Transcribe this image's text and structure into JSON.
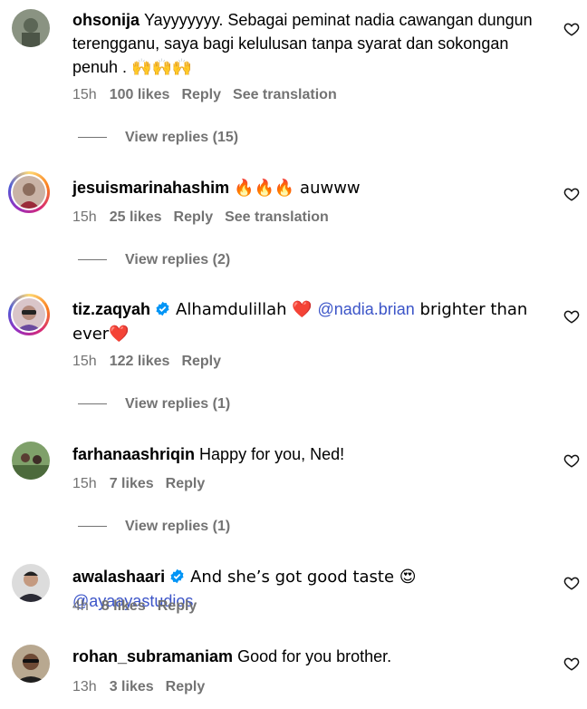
{
  "comments": [
    {
      "username": "ohsonija",
      "text": "Yayyyyyyy. Sebagai peminat nadia cawangan dungun terengganu, saya bagi kelulusan tanpa syarat dan sokongan penuh . 🙌🙌🙌",
      "time": "15h",
      "likes": "100 likes",
      "reply": "Reply",
      "translation": "See translation",
      "view_replies": "View replies (15)"
    },
    {
      "username": "jesuismarinahashim",
      "text": "🔥🔥🔥 auwww",
      "time": "15h",
      "likes": "25 likes",
      "reply": "Reply",
      "translation": "See translation",
      "view_replies": "View replies (2)"
    },
    {
      "username": "tiz.zaqyah",
      "text_before": "Alhamdulillah ❤️ ",
      "mention": "@nadia.brian",
      "text_after": " brighter than ever❤️",
      "time": "15h",
      "likes": "122 likes",
      "reply": "Reply",
      "view_replies": "View replies (1)"
    },
    {
      "username": "farhanaashriqin",
      "text": "Happy for you, Ned!",
      "time": "15h",
      "likes": "7 likes",
      "reply": "Reply",
      "view_replies": "View replies (1)"
    },
    {
      "username": "awalashaari",
      "text_before": "And she’s got good taste 😍 ",
      "mention": "@ayaayastudios",
      "time": "4h",
      "likes": "8 likes",
      "reply": "Reply"
    },
    {
      "username": "rohan_subramaniam",
      "text": "Good for you brother.",
      "time": "13h",
      "likes": "3 likes",
      "reply": "Reply"
    }
  ],
  "colors": {
    "mention": "#3c55c8",
    "meta": "#737373",
    "verified": "#0095f6"
  }
}
